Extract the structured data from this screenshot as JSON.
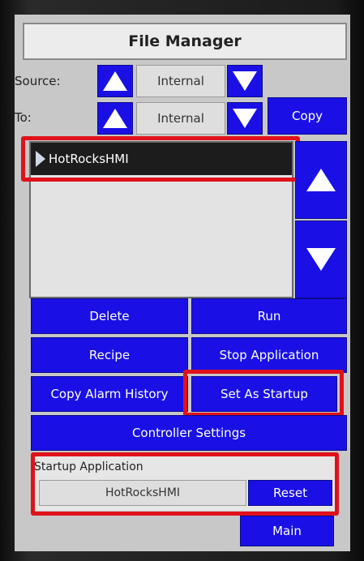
{
  "title": "File Manager",
  "source": {
    "label": "Source:",
    "value": "Internal"
  },
  "to": {
    "label": "To:",
    "value": "Internal"
  },
  "copy_label": "Copy",
  "file_list": {
    "items": [
      "HotRocksHMI"
    ]
  },
  "buttons": {
    "delete": "Delete",
    "run": "Run",
    "recipe": "Recipe",
    "stop_application": "Stop Application",
    "copy_alarm_history": "Copy Alarm History",
    "set_as_startup": "Set As Startup",
    "controller_settings": "Controller Settings",
    "reset": "Reset",
    "main": "Main"
  },
  "startup": {
    "label": "Startup Application",
    "value": "HotRocksHMI"
  },
  "icons": {
    "scroll_up": "triangle-up-icon",
    "scroll_down": "triangle-down-icon",
    "row_pointer": "triangle-right-icon"
  },
  "colors": {
    "button_blue": "#1a10e6",
    "highlight_red": "#e0111b",
    "screen_gray": "#c8c8c8"
  }
}
